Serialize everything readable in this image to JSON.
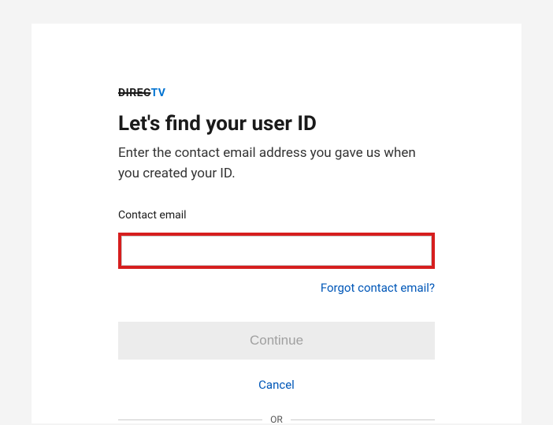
{
  "logo": {
    "part1": "DIREC",
    "part2": "TV"
  },
  "heading": "Let's find your user ID",
  "subtitle": "Enter the contact email address you gave us when you created your ID.",
  "form": {
    "email_label": "Contact email",
    "email_value": "",
    "forgot_link": "Forgot contact email?",
    "continue_label": "Continue",
    "cancel_label": "Cancel"
  },
  "divider": "OR"
}
